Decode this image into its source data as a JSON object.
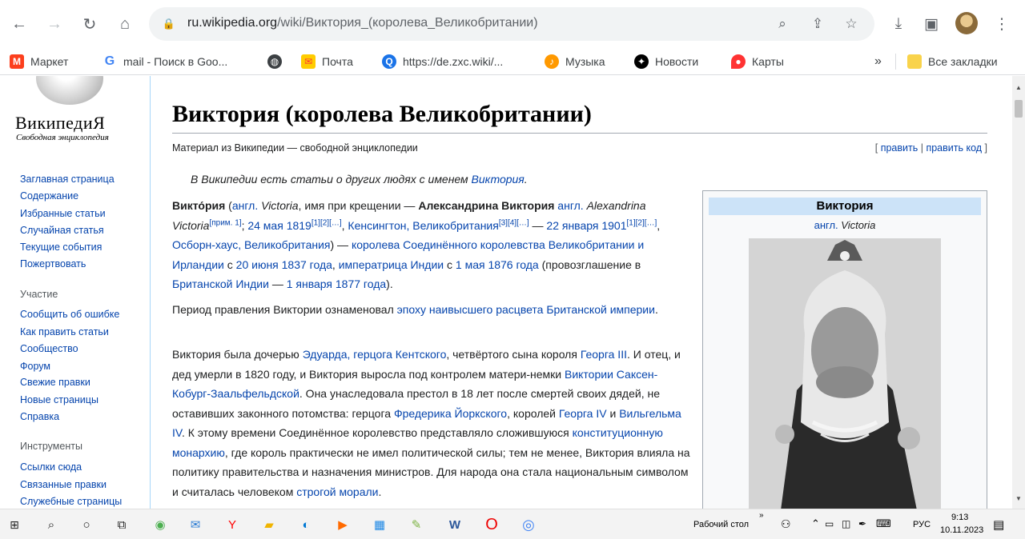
{
  "browser": {
    "url_host": "ru.wikipedia.org",
    "url_path": "/wiki/Виктория_(королева_Великобритании)"
  },
  "bookmarks": [
    {
      "label": "Маркет",
      "icon": "yandex-market-icon",
      "color": "#fc3f1d"
    },
    {
      "label": "mail - Поиск в Goo...",
      "icon": "google-icon",
      "color": "#4285f4"
    },
    {
      "label": "",
      "icon": "globe-icon",
      "color": "#3c4043"
    },
    {
      "label": "Почта",
      "icon": "mail-icon",
      "color": "#fc0"
    },
    {
      "label": "https://de.zxc.wiki/...",
      "icon": "zxc-icon",
      "color": "#1a73e8"
    },
    {
      "label": "Музыка",
      "icon": "music-icon",
      "color": "#ff9900"
    },
    {
      "label": "Новости",
      "icon": "news-icon",
      "color": "#000000"
    },
    {
      "label": "Карты",
      "icon": "maps-icon",
      "color": "#ff3333"
    }
  ],
  "bookmarks_overflow": "»",
  "all_bookmarks": "Все закладки",
  "sidebar": {
    "logo_title": "ВикипедиЯ",
    "logo_sub": "Свободная энциклопедия",
    "nav": [
      "Заглавная страница",
      "Содержание",
      "Избранные статьи",
      "Случайная статья",
      "Текущие события",
      "Пожертвовать"
    ],
    "participation_head": "Участие",
    "participation": [
      "Сообщить об ошибке",
      "Как править статьи",
      "Сообщество",
      "Форум",
      "Свежие правки",
      "Новые страницы",
      "Справка"
    ],
    "tools_head": "Инструменты",
    "tools": [
      "Ссылки сюда",
      "Связанные правки",
      "Служебные страницы"
    ]
  },
  "article": {
    "title": "Виктория (королева Великобритании)",
    "tagline": "Материал из Википедии — свободной энциклопедии",
    "edit": "править",
    "edit_code": "править код",
    "hatnote_text": "В Википедии есть статьи о других людях с именем ",
    "hatnote_link": "Виктория",
    "p2": "Период правления Виктории ознаменовал ",
    "p2_link": "эпоху наивысшего расцвета Британской империи"
  },
  "infobox": {
    "title": "Виктория",
    "sub_link": "англ.",
    "sub_text": " Victoria"
  },
  "taskbar": {
    "desktop": "Рабочий стол",
    "lang": "РУС",
    "time": "9:13",
    "date": "10.11.2023"
  }
}
